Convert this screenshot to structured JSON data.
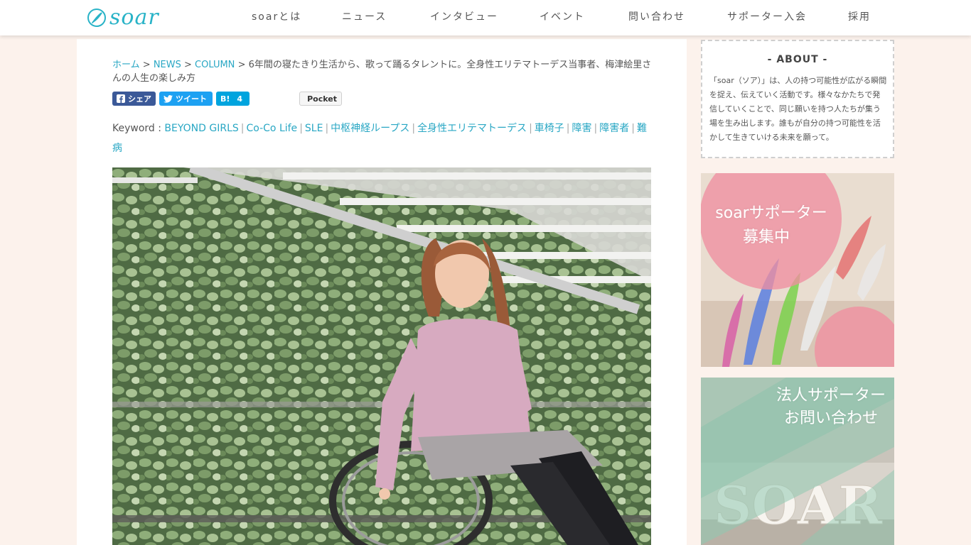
{
  "header": {
    "logo_text": "soar",
    "nav": [
      "soarとは",
      "ニュース",
      "インタビュー",
      "イベント",
      "問い合わせ",
      "サポーター入会",
      "採用"
    ]
  },
  "breadcrumb": {
    "home": "ホーム",
    "news": "NEWS",
    "column": "COLUMN",
    "separator": ">",
    "title": "6年間の寝たきり生活から、歌って踊るタレントに。全身性エリテマトーデス当事者、梅津絵里さんの人生の楽しみ方"
  },
  "share": {
    "facebook": "シェア",
    "twitter": "ツイート",
    "hatena": "B!",
    "hatena_count": "4",
    "pocket": "Pocket"
  },
  "keywords": {
    "label": "Keyword : ",
    "items": [
      "BEYOND GIRLS",
      "Co-Co Life",
      "SLE",
      "中枢神経ループス",
      "全身性エリテマトーデス",
      "車椅子",
      "障害",
      "障害者",
      "難病"
    ],
    "separator": "|"
  },
  "sidebar": {
    "about_title": "- ABOUT -",
    "about_text": "「soar（ソア）」は、人の持つ可能性が広がる瞬間を捉え、伝えていく活動です。様々なかたちで発信していくことで、同じ願いを持つ人たちが集う場を生み出します。誰もが自分の持つ可能性を活かして生きていける未来を願って。",
    "banner1_line1": "soarサポーター",
    "banner1_line2": "募集中",
    "banner2_line1": "法人サポーター",
    "banner2_line2": "お問い合わせ"
  },
  "colors": {
    "accent": "#29a7c4",
    "background": "#fcf2ec",
    "facebook": "#3b5998",
    "twitter": "#1da1f2",
    "hatena": "#00a4de",
    "pocket": "#ee4056"
  }
}
